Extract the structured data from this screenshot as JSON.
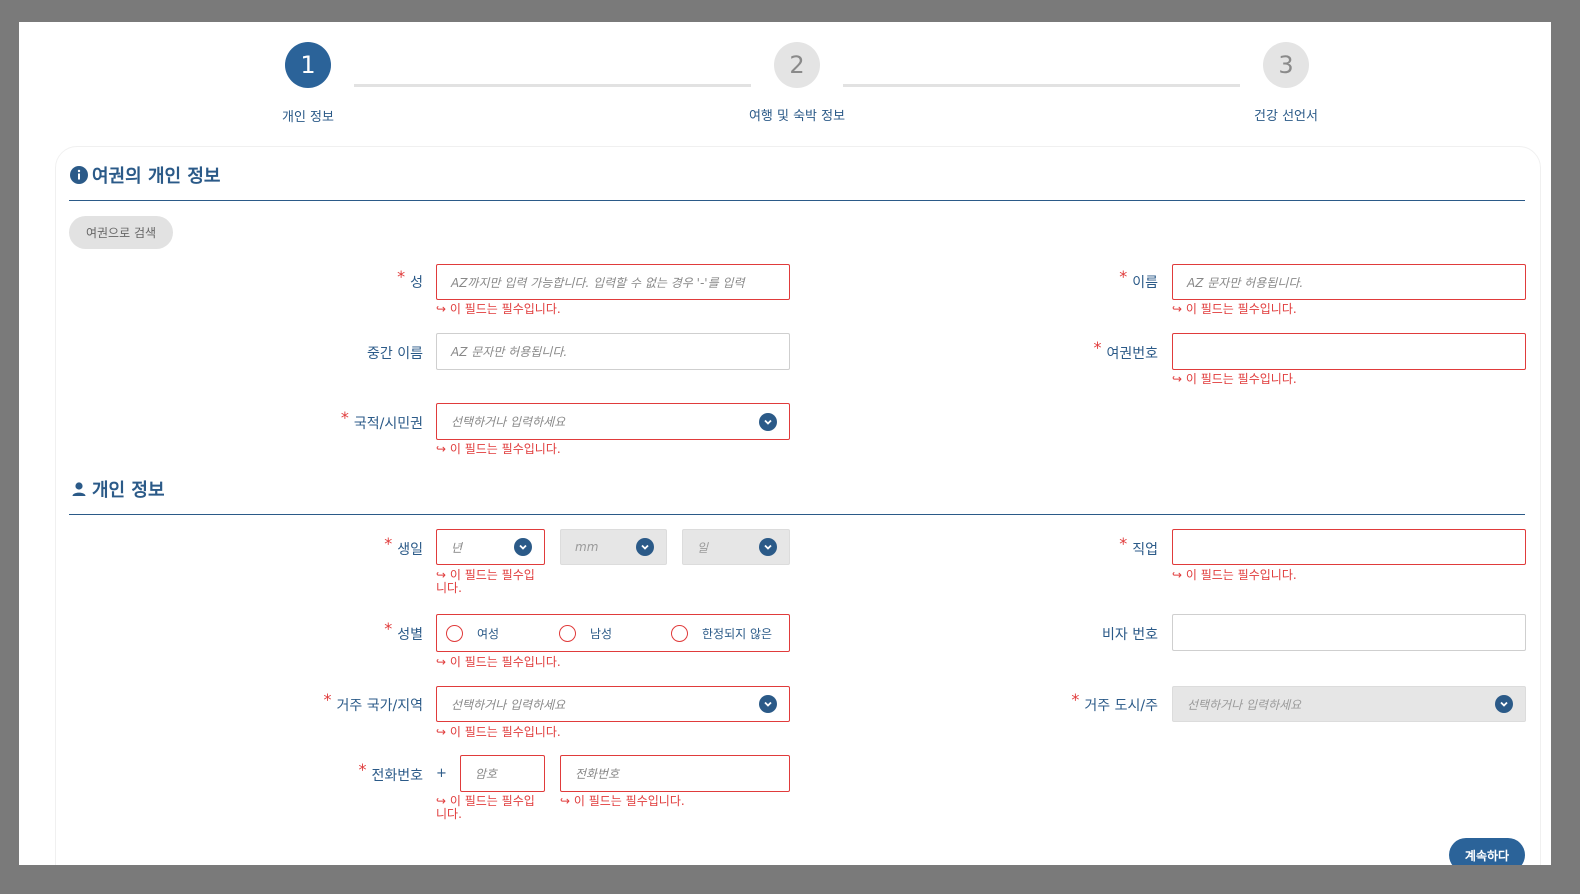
{
  "stepper": {
    "steps": [
      {
        "number": "1",
        "label": "개인 정보",
        "active": true
      },
      {
        "number": "2",
        "label": "여행 및 숙박 정보",
        "active": false
      },
      {
        "number": "3",
        "label": "건강 선언서",
        "active": false
      }
    ]
  },
  "passport_section": {
    "title": "여권의 개인 정보",
    "icon": "info-icon",
    "search_button": "여권으로 검색",
    "fields": {
      "surname": {
        "label": "성",
        "placeholder": "AZ까지만 입력 가능합니다. 입력할 수 없는 경우 '-'를 입력",
        "error": "이 필드는 필수입니다."
      },
      "given_name": {
        "label": "이름",
        "placeholder": "AZ 문자만 허용됩니다.",
        "error": "이 필드는 필수입니다."
      },
      "middle_name": {
        "label": "중간 이름",
        "placeholder": "AZ 문자만 허용됩니다."
      },
      "passport_number": {
        "label": "여권번호",
        "placeholder": "",
        "error": "이 필드는 필수입니다."
      },
      "nationality": {
        "label": "국적/시민권",
        "placeholder": "선택하거나 입력하세요",
        "error": "이 필드는 필수입니다."
      }
    }
  },
  "personal_section": {
    "title": "개인 정보",
    "icon": "person-icon",
    "fields": {
      "birthdate": {
        "label": "생일",
        "year_placeholder": "년",
        "month_placeholder": "mm",
        "day_placeholder": "일",
        "error_line1": "이 필드는 필수입",
        "error_line2": "니다."
      },
      "occupation": {
        "label": "직업",
        "placeholder": "",
        "error": "이 필드는 필수입니다."
      },
      "gender": {
        "label": "성별",
        "options": [
          "여성",
          "남성",
          "한정되지 않은"
        ],
        "error": "이 필드는 필수입니다."
      },
      "visa_number": {
        "label": "비자 번호",
        "placeholder": ""
      },
      "residence_country": {
        "label": "거주 국가/지역",
        "placeholder": "선택하거나 입력하세요",
        "error": "이 필드는 필수입니다."
      },
      "residence_city": {
        "label": "거주 도시/주",
        "placeholder": "선택하거나 입력하세요"
      },
      "phone": {
        "label": "전화번호",
        "plus": "+",
        "code_placeholder": "암호",
        "number_placeholder": "전화번호",
        "code_error_line1": "이 필드는 필수입",
        "code_error_line2": "니다.",
        "number_error": "이 필드는 필수입니다."
      }
    }
  },
  "continue_button": "계속하다",
  "colors": {
    "primary": "#2b6399",
    "error": "#e03b3b",
    "text": "#2b5a88"
  }
}
